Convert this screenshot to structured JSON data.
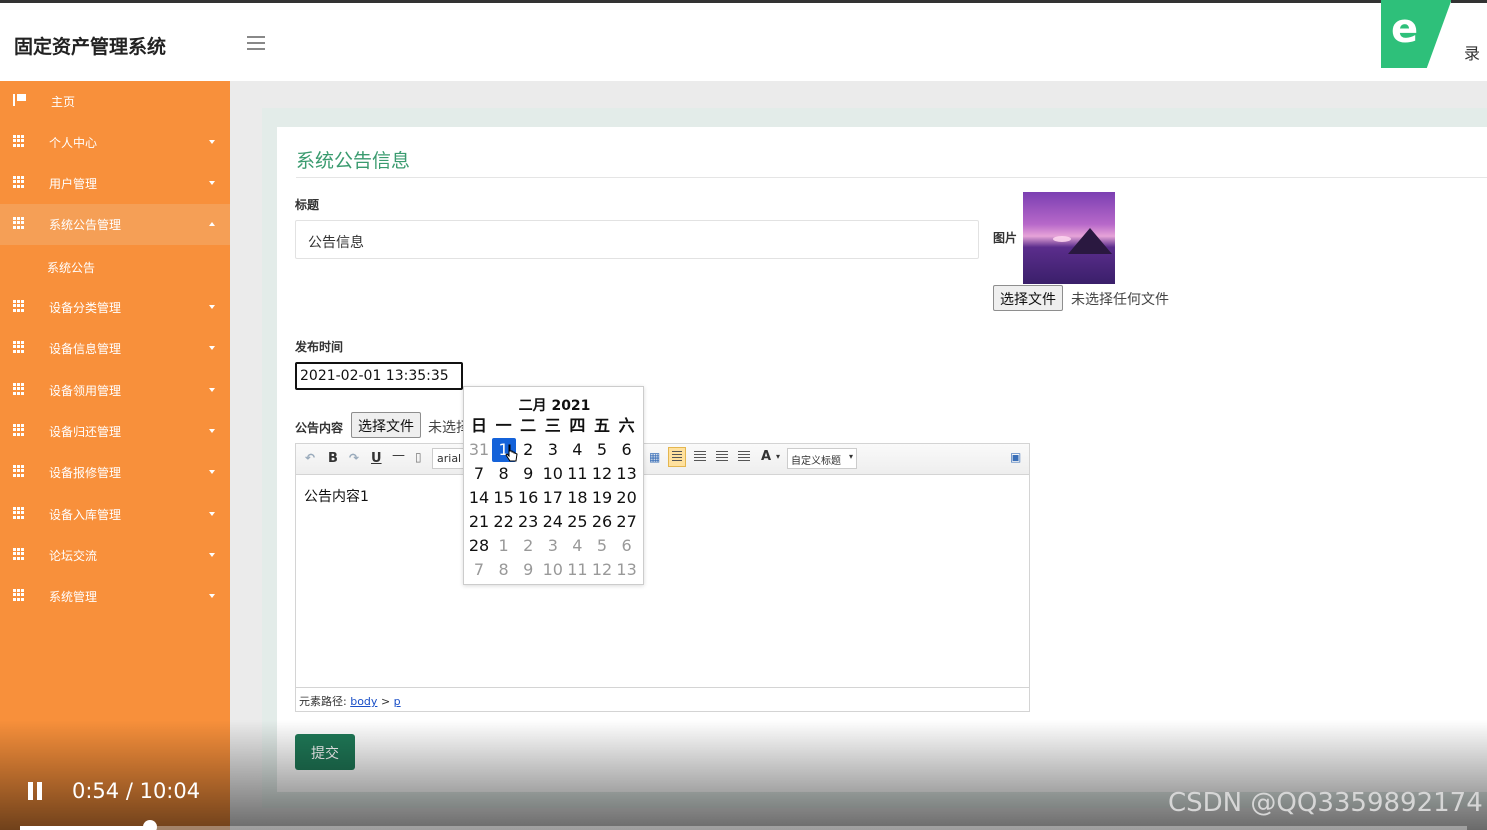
{
  "app": {
    "title": "固定资产管理系统",
    "corner_logo_text": "录"
  },
  "sidebar": {
    "items": [
      {
        "label": "主页",
        "icon": "flag-icon"
      },
      {
        "label": "个人中心",
        "icon": "grid-icon"
      },
      {
        "label": "用户管理",
        "icon": "grid-icon"
      },
      {
        "label": "系统公告管理",
        "icon": "grid-icon",
        "expanded": true
      },
      {
        "label": "系统公告",
        "sub": true
      },
      {
        "label": "设备分类管理",
        "icon": "grid-icon"
      },
      {
        "label": "设备信息管理",
        "icon": "grid-icon"
      },
      {
        "label": "设备领用管理",
        "icon": "grid-icon"
      },
      {
        "label": "设备归还管理",
        "icon": "grid-icon"
      },
      {
        "label": "设备报修管理",
        "icon": "grid-icon"
      },
      {
        "label": "设备入库管理",
        "icon": "grid-icon"
      },
      {
        "label": "论坛交流",
        "icon": "grid-icon"
      },
      {
        "label": "系统管理",
        "icon": "grid-icon"
      }
    ]
  },
  "form": {
    "heading": "系统公告信息",
    "title_label": "标题",
    "title_value": "公告信息",
    "image_label": "图片",
    "image_button": "选择文件",
    "image_status": "未选择任何文件",
    "time_label": "发布时间",
    "time_value": "2021-02-01 13:35:35",
    "content_label": "公告内容",
    "content_button": "选择文件",
    "content_status": "未选择",
    "submit_label": "提交"
  },
  "editor": {
    "toolbar": {
      "bold": "B",
      "underline": "U",
      "font": "arial",
      "font_color": "A",
      "style": "自定义标题"
    },
    "body": "公告内容1",
    "path_label": "元素路径:",
    "path_body": "body",
    "path_sep": ">",
    "path_p": "p"
  },
  "calendar": {
    "title": "二月 2021",
    "weekdays": [
      "日",
      "一",
      "二",
      "三",
      "四",
      "五",
      "六"
    ],
    "weeks": [
      [
        "31",
        "1",
        "2",
        "3",
        "4",
        "5",
        "6"
      ],
      [
        "7",
        "8",
        "9",
        "10",
        "11",
        "12",
        "13"
      ],
      [
        "14",
        "15",
        "16",
        "17",
        "18",
        "19",
        "20"
      ],
      [
        "21",
        "22",
        "23",
        "24",
        "25",
        "26",
        "27"
      ],
      [
        "28",
        "1",
        "2",
        "3",
        "4",
        "5",
        "6"
      ],
      [
        "7",
        "8",
        "9",
        "10",
        "11",
        "12",
        "13"
      ]
    ],
    "selected": "1"
  },
  "video": {
    "timecode": "0:54 / 10:04",
    "progress": 0.09
  },
  "watermark": "CSDN @QQ3359892174",
  "colors": {
    "sidebar": "#f8903b",
    "heading": "#3a9b6f",
    "submit": "#1f7a58",
    "calendar_selected": "#1462d9"
  }
}
